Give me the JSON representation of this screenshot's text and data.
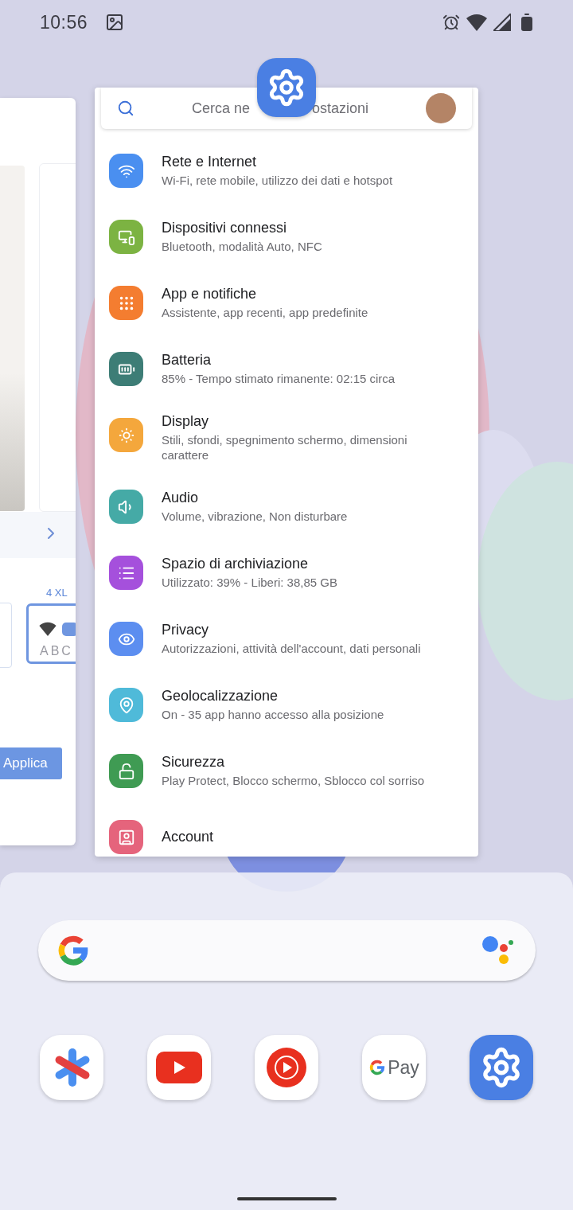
{
  "status_bar": {
    "time": "10:56"
  },
  "left_card": {
    "size_label": "4 XL",
    "sample_text": "ABC",
    "apply_button": "Applica"
  },
  "settings_card": {
    "search": {
      "placeholder_before": "Cerca ne",
      "placeholder_after": "ostazioni"
    },
    "items": [
      {
        "title": "Rete e Internet",
        "subtitle": "Wi-Fi, rete mobile, utilizzo dei dati e hotspot",
        "color": "#4a8ff0"
      },
      {
        "title": "Dispositivi connessi",
        "subtitle": "Bluetooth, modalità Auto, NFC",
        "color": "#7cb342"
      },
      {
        "title": "App e notifiche",
        "subtitle": "Assistente, app recenti, app predefinite",
        "color": "#f47d30"
      },
      {
        "title": "Batteria",
        "subtitle": "85% - Tempo stimato rimanente: 02:15 circa",
        "color": "#3d7d76"
      },
      {
        "title": "Display",
        "subtitle": "Stili, sfondi, spegnimento schermo, dimensioni carattere",
        "color": "#f4a73c"
      },
      {
        "title": "Audio",
        "subtitle": "Volume, vibrazione, Non disturbare",
        "color": "#45aaa6"
      },
      {
        "title": "Spazio di archiviazione",
        "subtitle": "Utilizzato: 39% - Liberi: 38,85 GB",
        "color": "#a550dc"
      },
      {
        "title": "Privacy",
        "subtitle": "Autorizzazioni, attività dell'account, dati personali",
        "color": "#5c8ef0"
      },
      {
        "title": "Geolocalizzazione",
        "subtitle": "On - 35 app hanno accesso alla posizione",
        "color": "#4fbad9"
      },
      {
        "title": "Sicurezza",
        "subtitle": "Play Protect, Blocco schermo, Sblocco col sorriso",
        "color": "#3f9b53"
      },
      {
        "title": "Account",
        "color": "#e5647c"
      }
    ]
  },
  "dock": {
    "pay_label": "Pay"
  }
}
